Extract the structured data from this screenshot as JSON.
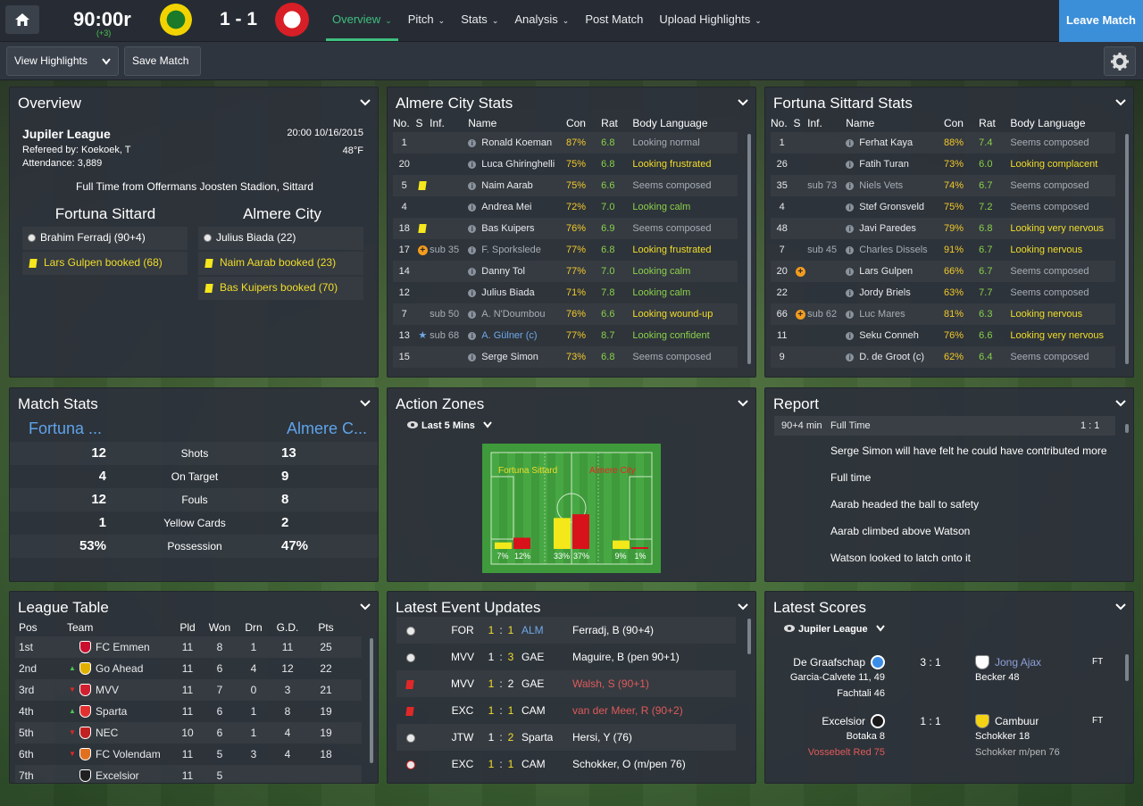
{
  "topbar": {
    "clock": "90:00r",
    "clock_sub": "(+3)",
    "score": "1 - 1",
    "nav": [
      "Overview",
      "Pitch",
      "Stats",
      "Analysis",
      "Post Match",
      "Upload Highlights"
    ],
    "leave": "Leave Match"
  },
  "subbar": {
    "view_highlights": "View Highlights",
    "save_match": "Save Match"
  },
  "overview": {
    "title": "Overview",
    "competition": "Jupiler League",
    "datetime": "20:00 10/16/2015",
    "referee": "Refereed by: Koekoek, T",
    "temp": "48°F",
    "attendance": "Attendance: 3,889",
    "fulltime": "Full Time from Offermans Joosten Stadion, Sittard",
    "home": "Fortuna Sittard",
    "away": "Almere City",
    "home_events": [
      {
        "icon": "ball",
        "text": "Brahim Ferradj (90+4)",
        "color": "white"
      },
      {
        "icon": "yellow",
        "text": "Lars Gulpen booked (68)",
        "color": "yellow"
      }
    ],
    "away_events": [
      {
        "icon": "ball",
        "text": "Julius Biada (22)",
        "color": "white"
      },
      {
        "icon": "yellow",
        "text": "Naim Aarab booked (23)",
        "color": "yellow"
      },
      {
        "icon": "yellow",
        "text": "Bas Kuipers booked (70)",
        "color": "yellow"
      }
    ]
  },
  "almere": {
    "title": "Almere City Stats",
    "headers": [
      "No.",
      "S",
      "Inf.",
      "Name",
      "Con",
      "Rat",
      "Body Language"
    ],
    "rows": [
      {
        "no": "1",
        "s": "",
        "inf": "",
        "name": "Ronald Koeman",
        "con": "87%",
        "rat": "6.8",
        "bl": "Looking normal",
        "blc": "grey"
      },
      {
        "no": "20",
        "s": "",
        "inf": "",
        "name": "Luca Ghiringhelli",
        "con": "75%",
        "rat": "6.8",
        "bl": "Looking frustrated",
        "blc": "yellow"
      },
      {
        "no": "5",
        "s": "yellow",
        "inf": "",
        "name": "Naim Aarab",
        "con": "75%",
        "rat": "6.6",
        "bl": "Seems composed",
        "blc": "grey"
      },
      {
        "no": "4",
        "s": "",
        "inf": "",
        "name": "Andrea Mei",
        "con": "72%",
        "rat": "7.0",
        "bl": "Looking calm",
        "blc": "green"
      },
      {
        "no": "18",
        "s": "yellow",
        "inf": "",
        "name": "Bas Kuipers",
        "con": "76%",
        "rat": "6.9",
        "bl": "Seems composed",
        "blc": "grey"
      },
      {
        "no": "17",
        "s": "sub",
        "inf": "sub 35",
        "name": "F. Sporkslede",
        "con": "77%",
        "rat": "6.8",
        "bl": "Looking frustrated",
        "blc": "yellow",
        "dim": true
      },
      {
        "no": "14",
        "s": "",
        "inf": "",
        "name": "Danny Tol",
        "con": "77%",
        "rat": "7.0",
        "bl": "Looking calm",
        "blc": "green"
      },
      {
        "no": "12",
        "s": "",
        "inf": "",
        "name": "Julius Biada",
        "con": "71%",
        "rat": "7.8",
        "bl": "Looking calm",
        "blc": "green"
      },
      {
        "no": "7",
        "s": "",
        "inf": "sub 50",
        "name": "A. N'Doumbou",
        "con": "76%",
        "rat": "6.6",
        "bl": "Looking wound-up",
        "blc": "yellow",
        "dim": true
      },
      {
        "no": "13",
        "s": "star",
        "inf": "sub 68",
        "name": "A. Gülner (c)",
        "con": "77%",
        "rat": "8.7",
        "bl": "Looking confident",
        "blc": "green",
        "blue": true
      },
      {
        "no": "15",
        "s": "",
        "inf": "",
        "name": "Serge Simon",
        "con": "73%",
        "rat": "6.8",
        "bl": "Seems composed",
        "blc": "grey"
      }
    ]
  },
  "fortuna": {
    "title": "Fortuna Sittard Stats",
    "headers": [
      "No.",
      "S",
      "Inf.",
      "Name",
      "Con",
      "Rat",
      "Body Language"
    ],
    "rows": [
      {
        "no": "1",
        "s": "",
        "inf": "",
        "name": "Ferhat Kaya",
        "con": "88%",
        "rat": "7.4",
        "bl": "Seems composed",
        "blc": "grey"
      },
      {
        "no": "26",
        "s": "",
        "inf": "",
        "name": "Fatih Turan",
        "con": "73%",
        "rat": "6.0",
        "bl": "Looking complacent",
        "blc": "yellow"
      },
      {
        "no": "35",
        "s": "",
        "inf": "sub 73",
        "name": "Niels Vets",
        "con": "74%",
        "rat": "6.7",
        "bl": "Seems composed",
        "blc": "grey",
        "dim": true
      },
      {
        "no": "4",
        "s": "",
        "inf": "",
        "name": "Stef Gronsveld",
        "con": "75%",
        "rat": "7.2",
        "bl": "Seems composed",
        "blc": "grey"
      },
      {
        "no": "48",
        "s": "",
        "inf": "",
        "name": "Javi Paredes",
        "con": "79%",
        "rat": "6.8",
        "bl": "Looking very nervous",
        "blc": "yellow"
      },
      {
        "no": "7",
        "s": "",
        "inf": "sub 45",
        "name": "Charles Dissels",
        "con": "91%",
        "rat": "6.7",
        "bl": "Looking nervous",
        "blc": "yellow",
        "dim": true
      },
      {
        "no": "20",
        "s": "sub",
        "inf": "",
        "name": "Lars Gulpen",
        "con": "66%",
        "rat": "6.7",
        "bl": "Seems composed",
        "blc": "grey"
      },
      {
        "no": "22",
        "s": "",
        "inf": "",
        "name": "Jordy Briels",
        "con": "63%",
        "rat": "7.7",
        "bl": "Seems composed",
        "blc": "grey"
      },
      {
        "no": "66",
        "s": "sub",
        "inf": "sub 62",
        "name": "Luc Mares",
        "con": "81%",
        "rat": "6.3",
        "bl": "Looking nervous",
        "blc": "yellow",
        "dim": true
      },
      {
        "no": "11",
        "s": "",
        "inf": "",
        "name": "Seku Conneh",
        "con": "76%",
        "rat": "6.6",
        "bl": "Looking very nervous",
        "blc": "yellow"
      },
      {
        "no": "9",
        "s": "",
        "inf": "",
        "name": "D. de Groot (c)",
        "con": "62%",
        "rat": "6.4",
        "bl": "Seems composed",
        "blc": "grey"
      }
    ]
  },
  "matchstats": {
    "title": "Match Stats",
    "home": "Fortuna ...",
    "away": "Almere C...",
    "rows": [
      {
        "h": "12",
        "label": "Shots",
        "a": "13"
      },
      {
        "h": "4",
        "label": "On Target",
        "a": "9"
      },
      {
        "h": "12",
        "label": "Fouls",
        "a": "8"
      },
      {
        "h": "1",
        "label": "Yellow Cards",
        "a": "2"
      },
      {
        "h": "53%",
        "label": "Possession",
        "a": "47%"
      }
    ]
  },
  "actionzones": {
    "title": "Action Zones",
    "filter": "Last 5 Mins",
    "home": "Fortuna Sittard",
    "away": "Almere City",
    "zones": [
      {
        "home": 7,
        "away": 12,
        "hl": "7%",
        "al": "12%"
      },
      {
        "home": 33,
        "away": 37,
        "hl": "33%",
        "al": "37%"
      },
      {
        "home": 9,
        "away": 1,
        "hl": "9%",
        "al": "1%"
      }
    ]
  },
  "report": {
    "title": "Report",
    "minute": "90+4 min",
    "status": "Full Time",
    "score": "1 : 1",
    "lines": [
      "Serge Simon will have felt he could have contributed more",
      "Full time",
      "Aarab headed the ball to safety",
      "Aarab climbed above Watson",
      "Watson looked to latch onto it"
    ]
  },
  "league": {
    "title": "League Table",
    "headers": [
      "Pos",
      "Team",
      "Pld",
      "Won",
      "Drn",
      "G.D.",
      "Pts"
    ],
    "rows": [
      {
        "pos": "1st",
        "move": "",
        "team": "FC Emmen",
        "pld": "11",
        "won": "8",
        "drn": "1",
        "gd": "11",
        "pts": "25",
        "crest": "#c8102e"
      },
      {
        "pos": "2nd",
        "move": "up",
        "team": "Go Ahead",
        "pld": "11",
        "won": "6",
        "drn": "4",
        "gd": "12",
        "pts": "22",
        "crest": "#e0b000"
      },
      {
        "pos": "3rd",
        "move": "down",
        "team": "MVV",
        "pld": "11",
        "won": "7",
        "drn": "0",
        "gd": "3",
        "pts": "21",
        "crest": "#d02030"
      },
      {
        "pos": "4th",
        "move": "up",
        "team": "Sparta",
        "pld": "11",
        "won": "6",
        "drn": "1",
        "gd": "8",
        "pts": "19",
        "crest": "#e03030"
      },
      {
        "pos": "5th",
        "move": "down",
        "team": "NEC",
        "pld": "10",
        "won": "6",
        "drn": "1",
        "gd": "4",
        "pts": "19",
        "crest": "#c02020"
      },
      {
        "pos": "6th",
        "move": "down",
        "team": "FC Volendam",
        "pld": "11",
        "won": "5",
        "drn": "3",
        "gd": "4",
        "pts": "18",
        "crest": "#e07020"
      },
      {
        "pos": "7th",
        "move": "",
        "team": "Excelsior",
        "pld": "11",
        "won": "5",
        "drn": "",
        "gd": "",
        "pts": "",
        "crest": "#202020"
      }
    ]
  },
  "events": {
    "title": "Latest Event Updates",
    "rows": [
      {
        "icon": "ball",
        "h": "FOR",
        "hs": "1",
        "as": "1",
        "a": "ALM",
        "desc": "Ferradj, B (90+4)",
        "hc": "yellow",
        "ac": "yellow",
        "blueaway": true,
        "red": false
      },
      {
        "icon": "ball",
        "h": "MVV",
        "hs": "1",
        "as": "3",
        "a": "GAE",
        "desc": "Maguire, B (pen 90+1)",
        "hc": "white",
        "ac": "yellow",
        "red": false
      },
      {
        "icon": "red",
        "h": "MVV",
        "hs": "1",
        "as": "2",
        "a": "GAE",
        "desc": "Walsh, S (90+1)",
        "hc": "yellow",
        "ac": "white",
        "red": true
      },
      {
        "icon": "red",
        "h": "EXC",
        "hs": "1",
        "as": "1",
        "a": "CAM",
        "desc": "van der Meer, R (90+2)",
        "hc": "yellow",
        "ac": "yellow",
        "red": true
      },
      {
        "icon": "ball",
        "h": "JTW",
        "hs": "1",
        "as": "2",
        "a": "Sparta",
        "desc": "Hersi, Y (76)",
        "hc": "white",
        "ac": "yellow",
        "red": false
      },
      {
        "icon": "ballred",
        "h": "EXC",
        "hs": "1",
        "as": "1",
        "a": "CAM",
        "desc": "Schokker, O (m/pen 76)",
        "hc": "yellow",
        "ac": "yellow",
        "red": false
      }
    ]
  },
  "scores": {
    "title": "Latest Scores",
    "comp": "Jupiler League",
    "matches": [
      {
        "home": "De Graafschap",
        "score": "3 : 1",
        "away": "Jong Ajax",
        "status": "FT",
        "hs": [
          "Garcia-Calvete 11, 49",
          "Fachtali 46"
        ],
        "as": [
          "Becker 48"
        ],
        "awayblue": true
      },
      {
        "home": "Excelsior",
        "score": "1 : 1",
        "away": "Cambuur",
        "status": "FT",
        "hs": [
          "Botaka 8",
          "Vossebelt Red 75"
        ],
        "as": [
          "Schokker 18",
          "Schokker m/pen 76"
        ],
        "awayblue": false
      }
    ]
  }
}
